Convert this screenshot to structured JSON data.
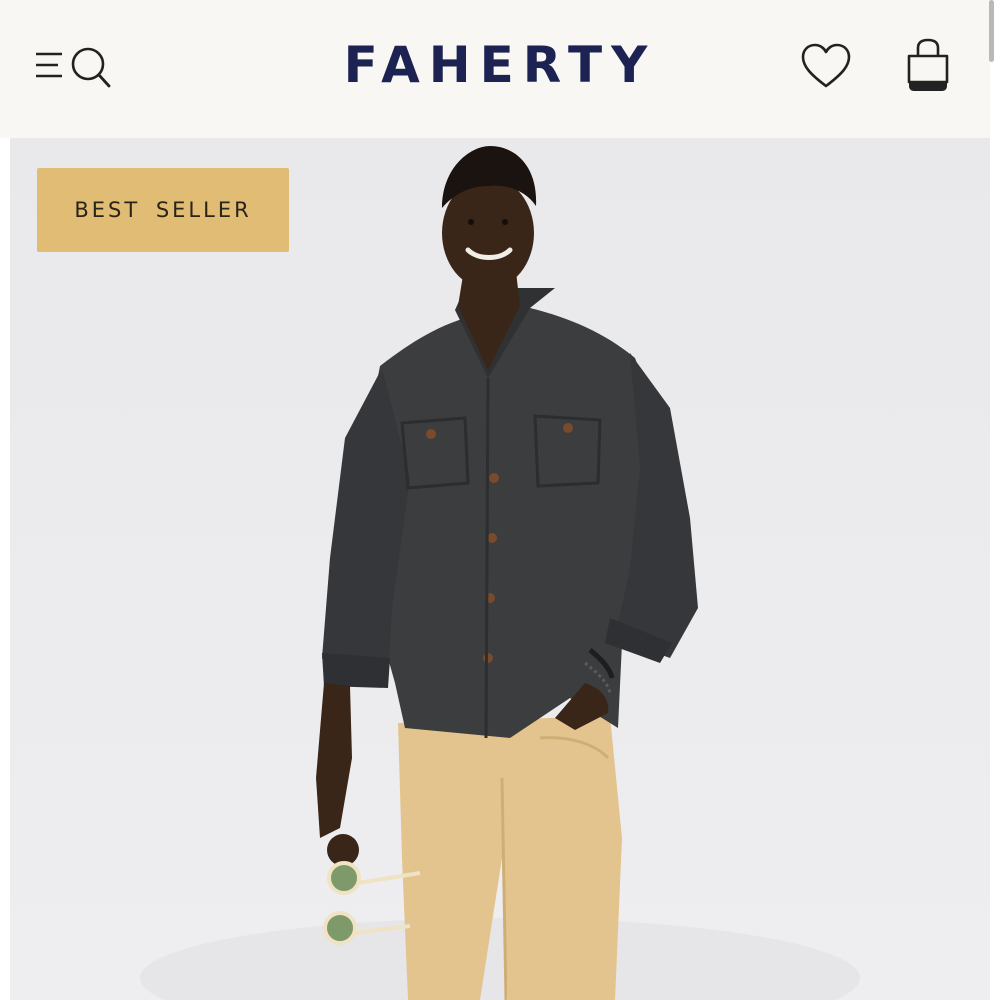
{
  "header": {
    "brand": "FAHERTY",
    "icons": {
      "menu": "menu-icon",
      "search": "search-icon",
      "wishlist": "heart-icon",
      "bag": "shopping-bag-icon"
    },
    "brand_color": "#1c2352",
    "background": "#f8f7f3"
  },
  "hero": {
    "badge_label": "BEST SELLER",
    "badge_color": "#e0bc74",
    "image": "product-photo-model-in-charcoal-shirt"
  }
}
